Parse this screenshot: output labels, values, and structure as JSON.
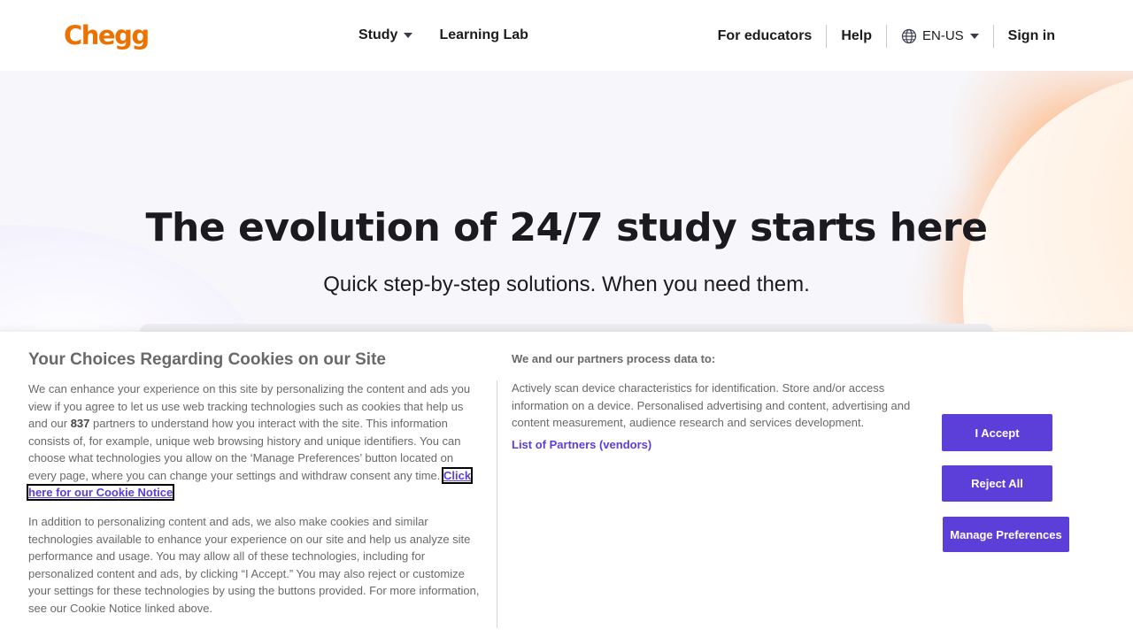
{
  "header": {
    "logo": "Chegg",
    "nav": [
      {
        "label": "Study",
        "has_dropdown": true
      },
      {
        "label": "Learning Lab",
        "has_dropdown": false
      }
    ],
    "for_educators": "For educators",
    "help": "Help",
    "language": "EN-US",
    "sign_in": "Sign in"
  },
  "hero": {
    "title": "The evolution of 24/7 study starts here",
    "subtitle": "Quick step-by-step solutions. When you need them."
  },
  "cookie_banner": {
    "title": "Your Choices Regarding Cookies on our Site",
    "p1_before": "We can enhance your experience on this site by personalizing the content and ads you view if you agree to let us use web tracking technologies such as cookies that help us and our ",
    "partner_count": "837",
    "p1_after": " partners to understand how you interact with the site. This information consists of, for example, unique web browsing history and unique identifiers. You can choose what technologies you allow on the ‘Manage Preferences’ button located on every page, where you can change your settings and withdraw consent any time. ",
    "cookie_notice_link": "Click here for our Cookie Notice",
    "p2": "In addition to personalizing content and ads, we also make cookies and similar technologies available to enhance your experience on our site and help us analyze site performance and usage. You may allow all of these technologies, including for personalized content and ads, by clicking “I Accept.” You may also reject or customize your settings for these technologies by using the buttons provided. For more information, see our Cookie Notice linked above.",
    "right_title": "We and our partners process data to:",
    "right_text": "Actively scan device characteristics for identification. Store and/or access information on a device. Personalised advertising and content, advertising and content measurement, audience research and services development.",
    "partners_link": "List of Partners (vendors)",
    "accept_button": "I Accept",
    "reject_button": "Reject All",
    "manage_button": "Manage Preferences"
  },
  "colors": {
    "brand_orange": "#eb7100",
    "accent_purple": "#5c3ed8",
    "text_dark": "#1b1b1f",
    "text_gray": "#696969"
  }
}
